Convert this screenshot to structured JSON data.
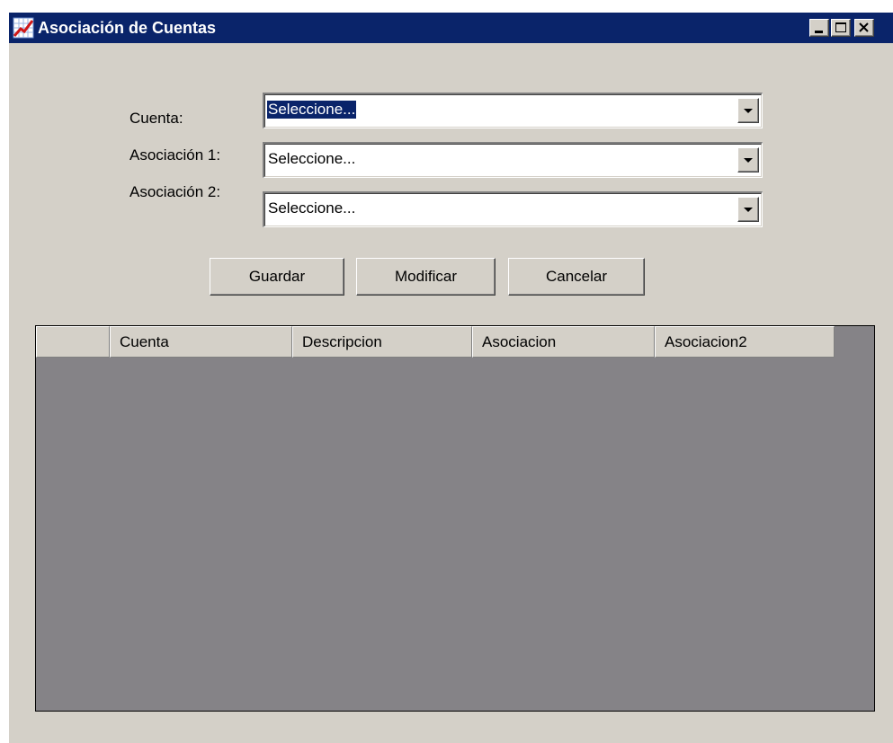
{
  "window": {
    "title": "Asociación de Cuentas",
    "icon": "chart-app-icon",
    "controls": [
      "minimize-icon",
      "maximize-icon",
      "close-icon"
    ]
  },
  "form": {
    "cuenta": {
      "label": "Cuenta:",
      "value": "Seleccione..."
    },
    "asociacion1": {
      "label": "Asociación 1:",
      "value": "Seleccione..."
    },
    "asociacion2": {
      "label": "Asociación 2:",
      "value": "Seleccione..."
    }
  },
  "buttons": {
    "guardar": "Guardar",
    "modificar": "Modificar",
    "cancelar": "Cancelar"
  },
  "grid": {
    "columns": [
      "Cuenta",
      "Descripcion",
      "Asociacion",
      "Asociacion2"
    ],
    "rows": []
  },
  "colors": {
    "titlebar": "#0a246a",
    "window_bg": "#d4d0c8",
    "grid_bg": "#858387",
    "selection": "#0a246a"
  }
}
